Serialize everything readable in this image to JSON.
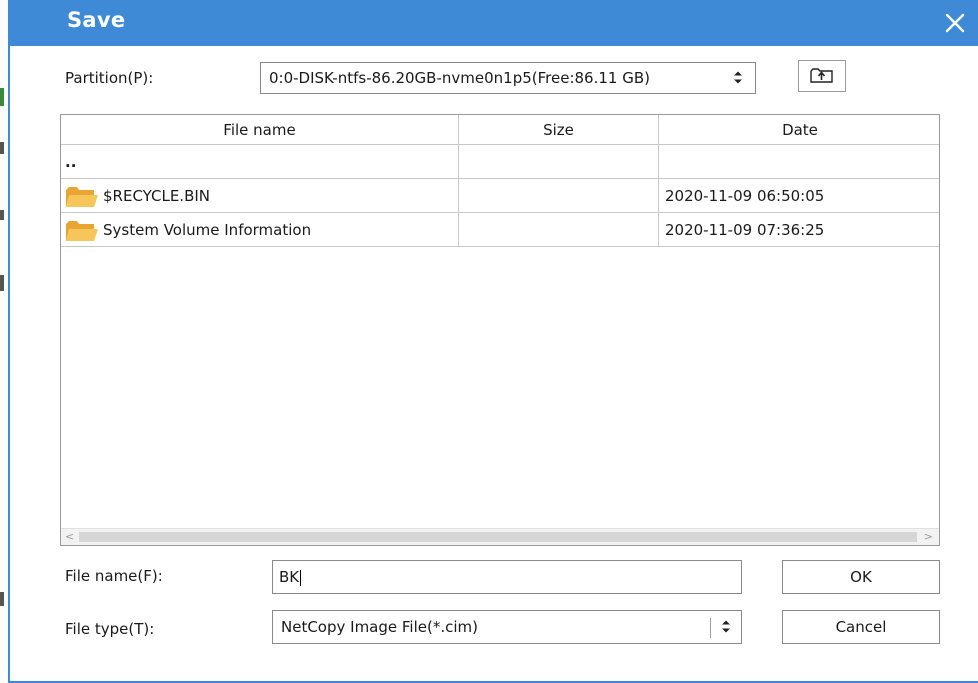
{
  "dialog": {
    "title": "Save",
    "close_icon": "close-icon"
  },
  "partition": {
    "label": "Partition(P):",
    "value": "0:0-DISK-ntfs-86.20GB-nvme0n1p5(Free:86.11 GB)",
    "spinner_icon": "spinner-icon",
    "up_folder_icon": "up-folder-icon"
  },
  "file_list": {
    "columns": [
      "File name",
      "Size",
      "Date"
    ],
    "rows": [
      {
        "name": "..",
        "size": "",
        "date": "",
        "icon": ""
      },
      {
        "name": "$RECYCLE.BIN",
        "size": "",
        "date": "2020-11-09 06:50:05",
        "icon": "folder-icon"
      },
      {
        "name": "System Volume Information",
        "size": "",
        "date": "2020-11-09 07:36:25",
        "icon": "folder-icon"
      }
    ],
    "scroll_left": "<",
    "scroll_right": ">"
  },
  "file_name": {
    "label": "File name(F):",
    "value": "BK"
  },
  "file_type": {
    "label": "File type(T):",
    "value": "NetCopy Image File(*.cim)"
  },
  "buttons": {
    "ok": "OK",
    "cancel": "Cancel"
  },
  "colors": {
    "titlebar": "#3e8ad6",
    "folder": "#f4b84a"
  }
}
